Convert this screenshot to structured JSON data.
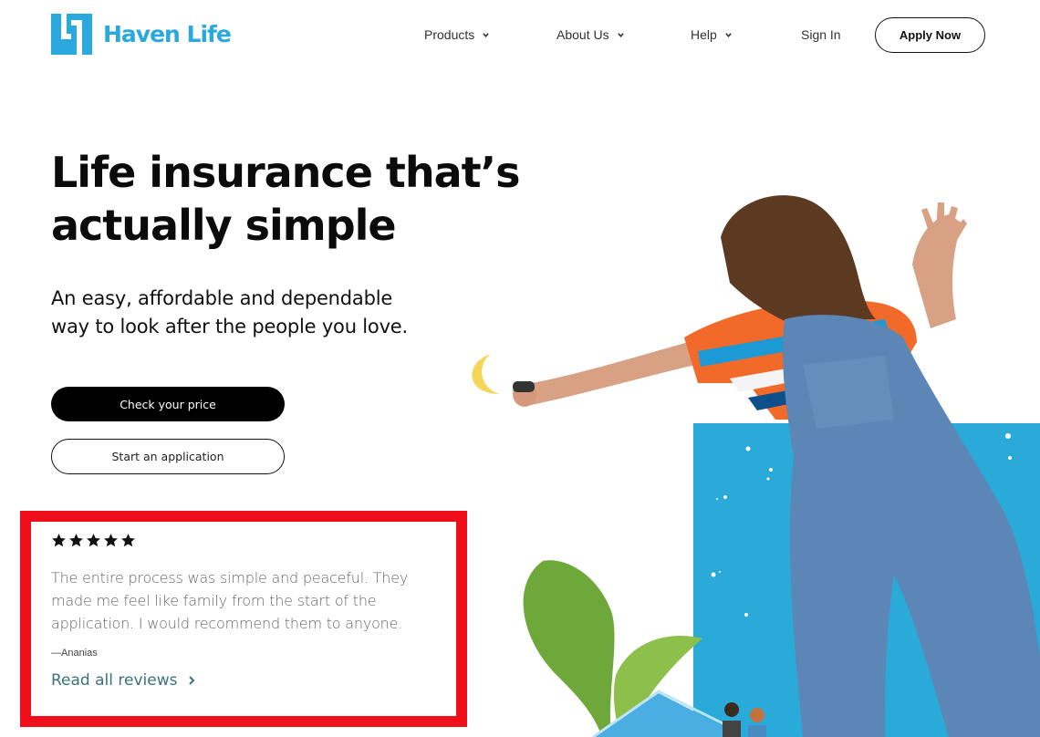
{
  "brand": {
    "name": "Haven Life",
    "color": "#2aa9de",
    "logo_icon": "haven-life-h-mark"
  },
  "nav": {
    "items": [
      {
        "label": "Products",
        "has_dropdown": true,
        "icon": "chevron-down-icon"
      },
      {
        "label": "About Us",
        "has_dropdown": true,
        "icon": "chevron-down-icon"
      },
      {
        "label": "Help",
        "has_dropdown": true,
        "icon": "chevron-down-icon"
      }
    ],
    "sign_in": "Sign In",
    "apply_now": "Apply Now"
  },
  "hero": {
    "title_line1": "Life insurance that’s",
    "title_line2": "actually simple",
    "subtitle_line1": "An easy, affordable and dependable",
    "subtitle_line2": "way to look after the people you love.",
    "primary_button": "Check your price",
    "secondary_button": "Start an application"
  },
  "review": {
    "rating": 5,
    "rating_max": 5,
    "text": "The entire process was simple and peaceful. They made me feel like family from the start of the application. I would recommend them to anyone.",
    "author": "—Ananias",
    "link_label": "Read all reviews",
    "link_icon": "chevron-right-icon",
    "highlight_color": "#ee0f1b"
  },
  "illustration": {
    "description": "Child in striped shirt and denim overalls reaching toward a crescent moon; blue panel with stars; green sprout leaves; blue house with two people",
    "panel_color": "#2aaad9",
    "moon_color": "#f4d65a"
  }
}
